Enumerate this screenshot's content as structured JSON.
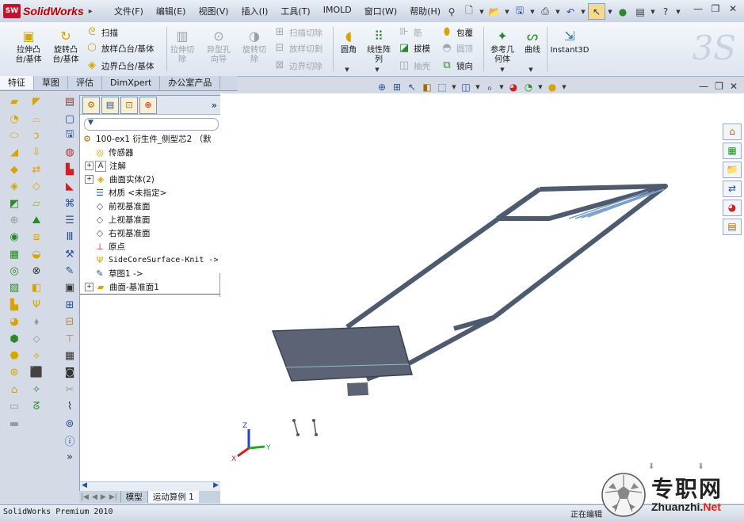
{
  "app": {
    "name": "SolidWorks",
    "badge": "SW",
    "arrow": "▸"
  },
  "menu": [
    "文件(F)",
    "编辑(E)",
    "视图(V)",
    "插入(I)",
    "工具(T)",
    "IMOLD",
    "窗口(W)",
    "帮助(H)"
  ],
  "ribbon": {
    "extrude_boss": "拉伸凸\n台/基体",
    "revolve_boss": "旋转凸\n台/基体",
    "sweep": "扫描",
    "loft_boss": "放样凸台/基体",
    "boundary_boss": "边界凸台/基体",
    "extrude_cut": "拉伸切\n除",
    "hole_wizard": "异型孔\n向导",
    "revolve_cut": "旋转切\n除",
    "sweep_cut": "扫描切除",
    "loft_cut": "放样切割",
    "boundary_cut": "边界切除",
    "fillet": "圆角",
    "linear_pattern": "线性阵\n列",
    "rib": "筋",
    "draft": "拔模",
    "shell": "抽壳",
    "wrap": "包覆",
    "dome": "圆顶",
    "mirror": "镜向",
    "ref_geometry": "参考几\n何体",
    "curves": "曲线",
    "instant3d": "Instant3D"
  },
  "cmd_tabs": [
    "特征",
    "草图",
    "评估",
    "DimXpert",
    "办公室产品"
  ],
  "tree": {
    "root": "100-ex1 衍生件_侧型芯2 （默",
    "items": [
      "传感器",
      "注解",
      "曲面实体(2)",
      "材质 <未指定>",
      "前视基准面",
      "上视基准面",
      "右视基准面",
      "原点",
      "SideCoreSurface-Knit ->",
      "草图1 ->",
      "曲面-基准面1"
    ]
  },
  "bottom_tabs": [
    "模型",
    "运动算例 1"
  ],
  "status": {
    "left": "SolidWorks Premium 2010",
    "mid": "正在编辑"
  },
  "watermark": {
    "cn": "专职网",
    "url_a": "Zhuanzhi.",
    "url_b": "Net"
  },
  "triad": {
    "x": "X",
    "y": "Y",
    "z": "Z"
  },
  "colors": {
    "model": "#4e5b6f",
    "accent": "#c8102e"
  }
}
